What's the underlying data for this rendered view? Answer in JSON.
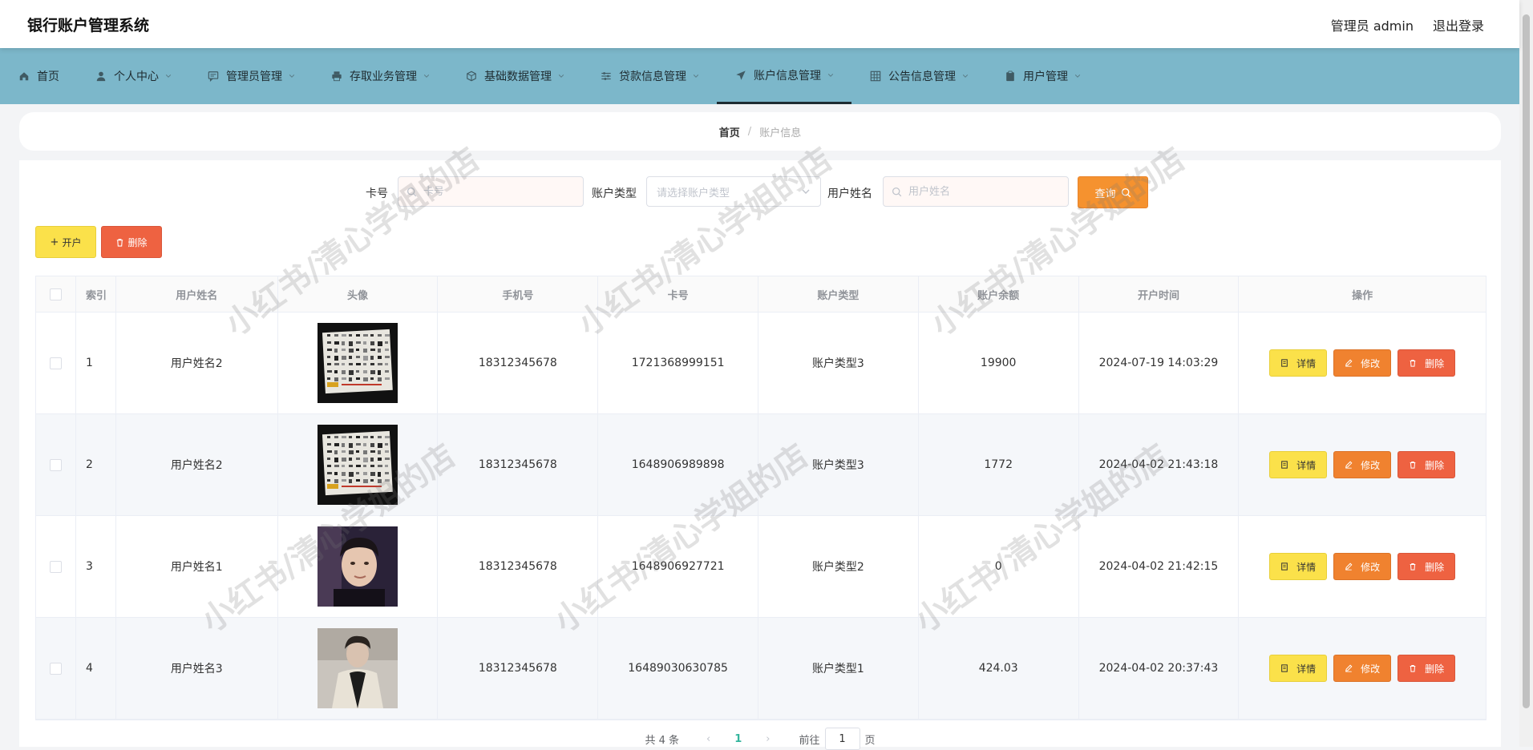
{
  "header": {
    "title": "银行账户管理系统",
    "user": "管理员 admin",
    "logout": "退出登录"
  },
  "nav": [
    {
      "label": "首页",
      "icon": "home-icon",
      "dropdown": false,
      "active": false
    },
    {
      "label": "个人中心",
      "icon": "user-icon",
      "dropdown": true,
      "active": false
    },
    {
      "label": "管理员管理",
      "icon": "chat-icon",
      "dropdown": true,
      "active": false
    },
    {
      "label": "存取业务管理",
      "icon": "printer-icon",
      "dropdown": true,
      "active": false
    },
    {
      "label": "基础数据管理",
      "icon": "cube-icon",
      "dropdown": true,
      "active": false
    },
    {
      "label": "贷款信息管理",
      "icon": "sliders-icon",
      "dropdown": true,
      "active": false
    },
    {
      "label": "账户信息管理",
      "icon": "send-icon",
      "dropdown": true,
      "active": true
    },
    {
      "label": "公告信息管理",
      "icon": "grid-icon",
      "dropdown": true,
      "active": false
    },
    {
      "label": "用户管理",
      "icon": "clipboard-icon",
      "dropdown": true,
      "active": false
    }
  ],
  "breadcrumb": {
    "home": "首页",
    "sep": "/",
    "current": "账户信息"
  },
  "search": {
    "card_label": "卡号",
    "card_placeholder": "卡号",
    "type_label": "账户类型",
    "type_placeholder": "请选择账户类型",
    "name_label": "用户姓名",
    "name_placeholder": "用户姓名",
    "query_label": "查询"
  },
  "actions": {
    "open_label": "开户",
    "delete_label": "删除"
  },
  "table": {
    "headers": [
      "索引",
      "用户姓名",
      "头像",
      "手机号",
      "卡号",
      "账户类型",
      "账户余额",
      "开户时间",
      "操作"
    ],
    "rows": [
      {
        "index": "1",
        "name": "用户姓名2",
        "avatar": "poster",
        "phone": "18312345678",
        "card": "1721368999151",
        "type": "账户类型3",
        "balance": "19900",
        "time": "2024-07-19 14:03:29"
      },
      {
        "index": "2",
        "name": "用户姓名2",
        "avatar": "poster",
        "phone": "18312345678",
        "card": "1648906989898",
        "type": "账户类型3",
        "balance": "1772",
        "time": "2024-04-02 21:43:18"
      },
      {
        "index": "3",
        "name": "用户姓名1",
        "avatar": "portrait-dark",
        "phone": "18312345678",
        "card": "1648906927721",
        "type": "账户类型2",
        "balance": "0",
        "time": "2024-04-02 21:42:15"
      },
      {
        "index": "4",
        "name": "用户姓名3",
        "avatar": "portrait-light",
        "phone": "18312345678",
        "card": "16489030630785",
        "type": "账户类型1",
        "balance": "424.03",
        "time": "2024-04-02 20:37:43"
      }
    ],
    "ops": {
      "detail": "详情",
      "edit": "修改",
      "remove": "删除"
    }
  },
  "pager": {
    "total": "共 4 条",
    "current": "1",
    "goto": "前往",
    "page_value": "1",
    "page_suffix": "页"
  },
  "watermark": "小红书/清心学姐的店",
  "colors": {
    "nav_bg": "#7cb7ca",
    "query": "#f5922f",
    "yellow": "#fbe14a",
    "orange": "#f0822f",
    "red": "#ee6241",
    "pager_active": "#34b59d"
  }
}
